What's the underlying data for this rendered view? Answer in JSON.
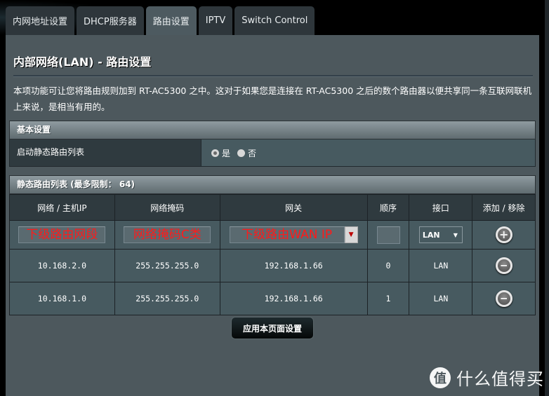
{
  "tabs": [
    {
      "label": "内网地址设置",
      "active": false
    },
    {
      "label": "DHCP服务器",
      "active": false
    },
    {
      "label": "路由设置",
      "active": true
    },
    {
      "label": "IPTV",
      "active": false
    },
    {
      "label": "Switch Control",
      "active": false
    }
  ],
  "page": {
    "title": "内部网络(LAN) - 路由设置",
    "description": "本项功能可让您将路由规则加到 RT-AC5300 之中。这对于如果您是连接在 RT-AC5300 之后的数个路由器以便共享同一条互联网联机上来说，是相当有用的。"
  },
  "basic": {
    "header": "基本设置",
    "enable_label": "启动静态路由列表",
    "options": [
      "是",
      "否"
    ],
    "selected": "是"
  },
  "route_list": {
    "header": "静态路由列表 (最多限制： 64)",
    "columns": [
      "网络 / 主机IP",
      "网络掩码",
      "网关",
      "顺序",
      "接口",
      "添加 / 移除"
    ],
    "input_row": {
      "network": "下级路由网段",
      "netmask": "网络掩码C类",
      "gateway": "下级路由WAN IP",
      "metric": "",
      "interface": "LAN"
    },
    "rows": [
      {
        "network": "10.168.2.0",
        "netmask": "255.255.255.0",
        "gateway": "192.168.1.66",
        "metric": "0",
        "interface": "LAN"
      },
      {
        "network": "10.168.1.0",
        "netmask": "255.255.255.0",
        "gateway": "192.168.1.66",
        "metric": "1",
        "interface": "LAN"
      }
    ]
  },
  "apply_label": "应用本页面设置",
  "watermark": {
    "logo_char": "值",
    "text": "什么值得买"
  },
  "icons": {
    "add": "plus-circle-icon",
    "remove": "minus-circle-icon",
    "dropdown": "triangle-down-icon"
  }
}
